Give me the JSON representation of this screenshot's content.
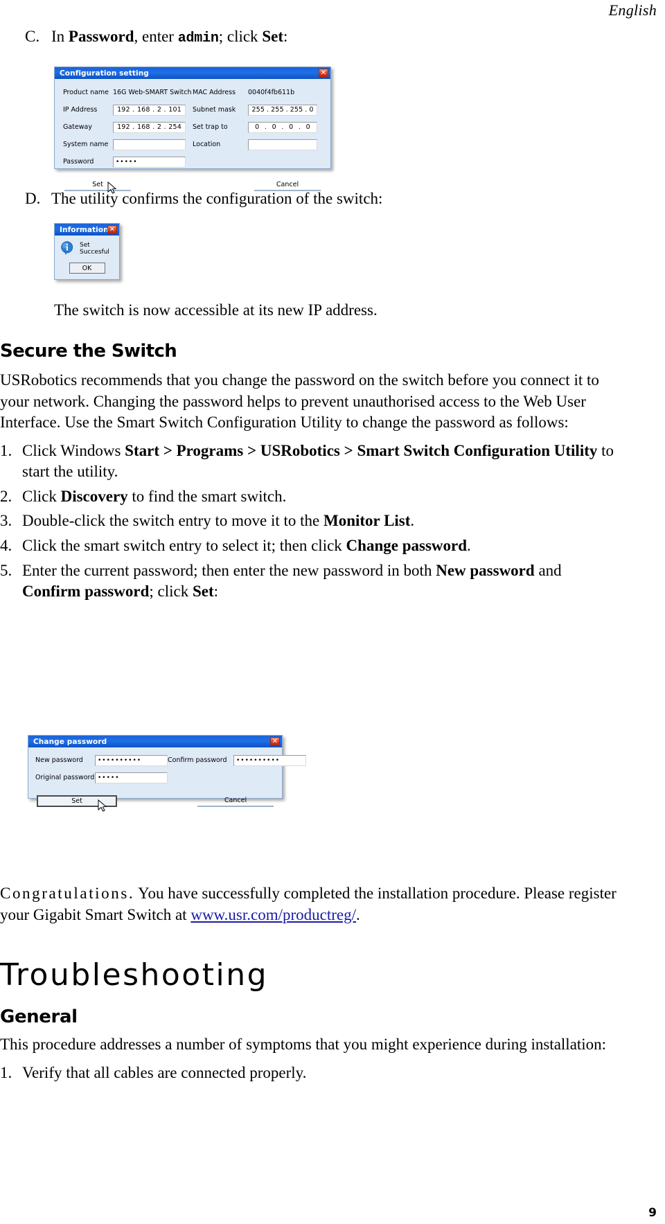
{
  "page": {
    "running_head": "English",
    "page_number": "9"
  },
  "steps_letters": [
    {
      "marker": "C.",
      "text_before": "In ",
      "bold1": "Password",
      "text_mid": ", enter ",
      "mono": "admin",
      "text_mid2": "; click ",
      "bold2": "Set",
      "text_after": ":"
    },
    {
      "marker": "D.",
      "text": "The utility confirms the configuration of the switch:"
    }
  ],
  "config_dialog": {
    "title": "Configuration setting",
    "close_label": "✕",
    "fields_left": [
      {
        "label": "Product name",
        "type": "static",
        "value": "16G Web-SMART Switch"
      },
      {
        "label": "IP Address",
        "type": "ip",
        "octets": [
          "192",
          "168",
          "2",
          "101"
        ]
      },
      {
        "label": "Gateway",
        "type": "ip",
        "octets": [
          "192",
          "168",
          "2",
          "254"
        ]
      },
      {
        "label": "System name",
        "type": "text",
        "value": ""
      },
      {
        "label": "Password",
        "type": "password",
        "value": "•••••"
      }
    ],
    "fields_right": [
      {
        "label": "MAC Address",
        "type": "static",
        "value": "0040f4fb611b"
      },
      {
        "label": "Subnet mask",
        "type": "ip",
        "octets": [
          "255",
          "255",
          "255",
          "0"
        ]
      },
      {
        "label": "Set trap to",
        "type": "ip",
        "octets": [
          "0",
          "0",
          "0",
          "0"
        ]
      },
      {
        "label": "Location",
        "type": "text",
        "value": ""
      }
    ],
    "set_label": "Set",
    "cancel_label": "Cancel"
  },
  "info_dialog": {
    "title": "Information",
    "close_label": "✕",
    "message": "Set Succesful",
    "ok_label": "OK",
    "icon": "information-icon"
  },
  "caption": "The switch is now accessible at its new IP address.",
  "secure_section": {
    "heading": "Secure the Switch",
    "paragraph": "USRobotics recommends that you change the password on the switch before you connect it to your network. Changing the password helps to prevent unauthorised access to the Web User Interface. Use the Smart Switch Configuration Utility to change the password as follows:",
    "steps": [
      {
        "num": "1.",
        "parts": [
          {
            "t": "Click Windows ",
            "b": false
          },
          {
            "t": "Start > Programs > USRobotics > Smart Switch Configuration Utility",
            "b": true
          },
          {
            "t": " to start the utility.",
            "b": false
          }
        ]
      },
      {
        "num": "2.",
        "parts": [
          {
            "t": "Click ",
            "b": false
          },
          {
            "t": "Discovery",
            "b": true
          },
          {
            "t": " to find the smart switch.",
            "b": false
          }
        ]
      },
      {
        "num": "3.",
        "parts": [
          {
            "t": "Double-click the switch entry to move it to the ",
            "b": false
          },
          {
            "t": "Monitor List",
            "b": true
          },
          {
            "t": ".",
            "b": false
          }
        ]
      },
      {
        "num": "4.",
        "parts": [
          {
            "t": "Click the smart switch entry to select it; then click ",
            "b": false
          },
          {
            "t": "Change password",
            "b": true
          },
          {
            "t": ".",
            "b": false
          }
        ]
      },
      {
        "num": "5.",
        "parts": [
          {
            "t": "Enter the current password; then enter the new password in both ",
            "b": false
          },
          {
            "t": "New password",
            "b": true
          },
          {
            "t": " and ",
            "b": false
          },
          {
            "t": "Confirm password",
            "b": true
          },
          {
            "t": "; click ",
            "b": false
          },
          {
            "t": "Set",
            "b": true
          },
          {
            "t": ":",
            "b": false
          }
        ]
      }
    ]
  },
  "changepw_dialog": {
    "title": "Change password",
    "close_label": "✕",
    "fields_left": [
      {
        "label": "New password",
        "value": "••••••••••"
      },
      {
        "label": "Original password",
        "value": "•••••"
      }
    ],
    "fields_right": [
      {
        "label": "Confirm password",
        "value": "••••••••••"
      }
    ],
    "set_label": "Set",
    "cancel_label": "Cancel"
  },
  "congrats": {
    "word": "Congratulations.",
    "text_before": " You have successfully completed the installation procedure. Please register your Gigabit Smart Switch at ",
    "link": "www.usr.com/productreg/",
    "text_after": "."
  },
  "troubleshooting": {
    "heading": "Troubleshooting",
    "sub_heading": "General",
    "paragraph": "This procedure addresses a number of symptoms that you might experience during installation:",
    "steps": [
      {
        "num": "1.",
        "text": "Verify that all cables are connected properly."
      }
    ]
  },
  "colors": {
    "title_bar_blue": "#1f6fe6",
    "dialog_face": "#dfeaf7",
    "close_red": "#d6391f",
    "link_blue": "#1a1aa8"
  }
}
